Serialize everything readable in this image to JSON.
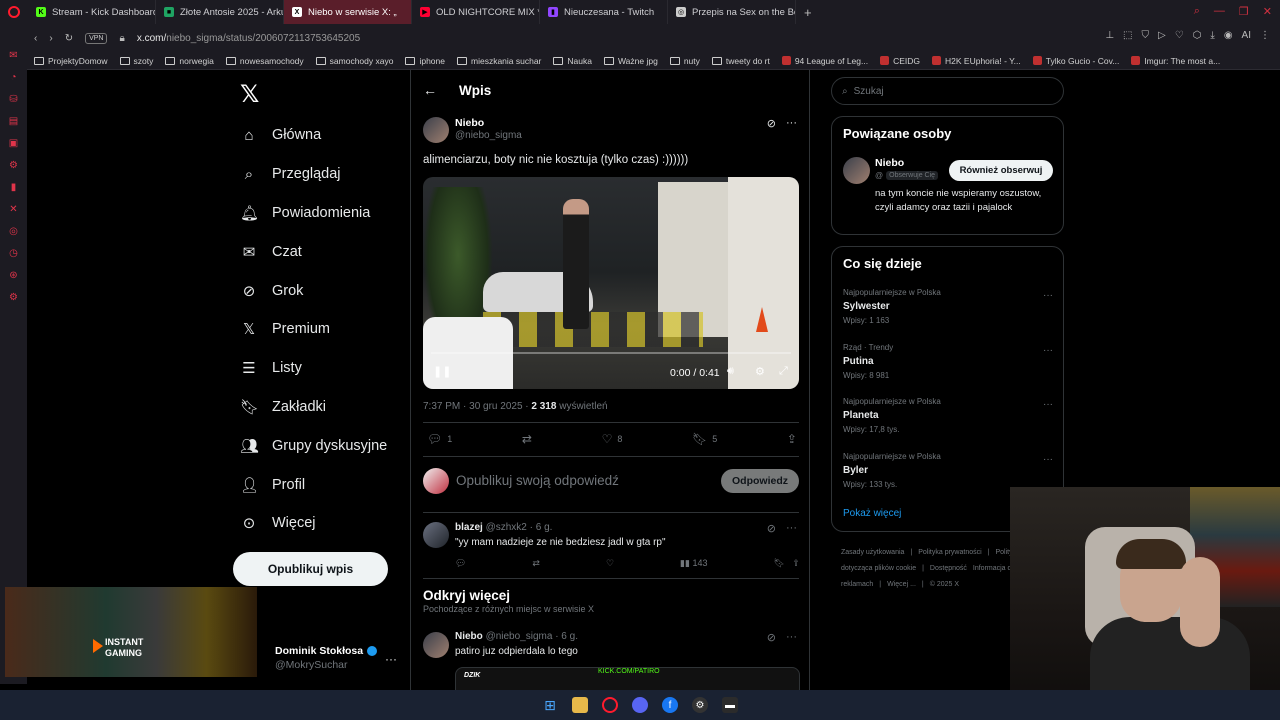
{
  "browser": {
    "tabs": [
      {
        "label": "Stream - Kick Dashboard",
        "fav_color": "#53fc18",
        "fav_glyph": "K",
        "active": false
      },
      {
        "label": "Złote Antosie 2025 - Arku",
        "fav_color": "#1fa463",
        "fav_glyph": "■",
        "active": false
      },
      {
        "label": "Niebo w serwisie X: „",
        "fav_color": "#ffffff",
        "fav_glyph": "X",
        "active": true
      },
      {
        "label": "OLD NIGHTCORE MIX *20",
        "fav_color": "#ff0033",
        "fav_glyph": "▶",
        "active": false
      },
      {
        "label": "Nieuczesana - Twitch",
        "fav_color": "#9146ff",
        "fav_glyph": "▮",
        "active": false
      },
      {
        "label": "Przepis na Sex on the Bea",
        "fav_color": "#cccccc",
        "fav_glyph": "◎",
        "active": false
      }
    ],
    "new_tab": "+",
    "vpn": "VPN",
    "url_host": "x.com/",
    "url_path": "niebo_sigma/status/2006072113753645205",
    "ai_label": "AI",
    "bookmarks": [
      {
        "label": "ProjektyDomow",
        "icon": "folder"
      },
      {
        "label": "szoty",
        "icon": "folder"
      },
      {
        "label": "norwegia",
        "icon": "folder"
      },
      {
        "label": "nowesamochody",
        "icon": "folder"
      },
      {
        "label": "samochody xayo",
        "icon": "folder"
      },
      {
        "label": "iphone",
        "icon": "folder"
      },
      {
        "label": "mieszkania suchar",
        "icon": "folder"
      },
      {
        "label": "Nauka",
        "icon": "folder"
      },
      {
        "label": "Ważne jpg",
        "icon": "folder"
      },
      {
        "label": "nuty",
        "icon": "folder"
      },
      {
        "label": "tweety do rt",
        "icon": "folder"
      },
      {
        "label": "94 League of Leg...",
        "icon": "site"
      },
      {
        "label": "CEIDG",
        "icon": "site"
      },
      {
        "label": "H2K EUphoria! - Y...",
        "icon": "site"
      },
      {
        "label": "Tylko Gucio - Cov...",
        "icon": "site"
      },
      {
        "label": "Imgur: The most a...",
        "icon": "site"
      }
    ]
  },
  "nav": {
    "items": [
      {
        "label": "Główna",
        "icon": "home-icon",
        "glyph": "⌂"
      },
      {
        "label": "Przeglądaj",
        "icon": "search-icon",
        "glyph": "⌕"
      },
      {
        "label": "Powiadomienia",
        "icon": "bell-icon",
        "glyph": "🔔︎"
      },
      {
        "label": "Czat",
        "icon": "mail-icon",
        "glyph": "✉"
      },
      {
        "label": "Grok",
        "icon": "grok-icon",
        "glyph": "⊘"
      },
      {
        "label": "Premium",
        "icon": "x-premium-icon",
        "glyph": "𝕏"
      },
      {
        "label": "Listy",
        "icon": "list-icon",
        "glyph": "☰"
      },
      {
        "label": "Zakładki",
        "icon": "bookmark-icon",
        "glyph": "🔖︎"
      },
      {
        "label": "Grupy dyskusyjne",
        "icon": "communities-icon",
        "glyph": "👥︎"
      },
      {
        "label": "Profil",
        "icon": "profile-icon",
        "glyph": "👤︎"
      },
      {
        "label": "Więcej",
        "icon": "more-icon",
        "glyph": "⊙"
      }
    ],
    "post_button": "Opublikuj wpis"
  },
  "account": {
    "name": "Dominik Stokłosa",
    "handle": "@MokrySuchar"
  },
  "overlay": {
    "brand_line1": "INSTANT",
    "brand_line2": "GAMING"
  },
  "main": {
    "header_title": "Wpis",
    "tweet": {
      "name": "Niebo",
      "handle": "@niebo_sigma",
      "text": "alimenciarzu, boty nic nie kosztuja (tylko czas)  :))))))",
      "video_time": "0:00 / 0:41",
      "video_progress": 0,
      "time": "7:37 PM · 30 gru 2025 · ",
      "views": "2 318",
      "views_label": " wyświetleń",
      "replies": "1",
      "likes": "8",
      "bookmarks": "5"
    },
    "reply_placeholder": "Opublikuj swoją odpowiedź",
    "reply_button": "Odpowiedz",
    "comment": {
      "name": "blazej",
      "handle": "@szhxk2 · 6 g.",
      "text": "\"yy mam nadzieje ze nie bedziesz jadl w gta rp\"",
      "views": "143"
    },
    "discover_title": "Odkryj więcej",
    "discover_sub": "Pochodzące z różnych miejsc w serwisie X",
    "discover_post": {
      "name": "Niebo",
      "handle": "@niebo_sigma · 6 g.",
      "text": "patiro juz odpierdala lo tego",
      "embed_left": "DZIK",
      "embed_right": "KICK.COM/PATIRO"
    }
  },
  "right": {
    "search_placeholder": "Szukaj",
    "related_title": "Powiązane osoby",
    "related": {
      "name": "Niebo",
      "handle": "@",
      "follows_you": "Obserwuje Cię",
      "button": "Również obserwuj",
      "bio": "na tym koncie nie wspieramy oszustow, czyli adamcy oraz tazii i pajalock"
    },
    "trends_title": "Co się dzieje",
    "trends": [
      {
        "context": "Najpopularniejsze w Polska",
        "name": "Sylwester",
        "count": "Wpisy: 1 163"
      },
      {
        "context": "Rząd · Trendy",
        "name": "Putina",
        "count": "Wpisy: 8 981"
      },
      {
        "context": "Najpopularniejsze w Polska",
        "name": "Planeta",
        "count": "Wpisy: 17,8 tys."
      },
      {
        "context": "Najpopularniejsze w Polska",
        "name": "Byler",
        "count": "Wpisy: 133 tys."
      }
    ],
    "show_more": "Pokaż więcej",
    "footer": [
      "Zasady użytkowania",
      "|",
      "Polityka prywatności",
      "|",
      "Polityka dotycząca plików cookie",
      "|",
      "Dostępność",
      "Informacja o reklamach",
      "|",
      "Więcej ...",
      "|",
      "© 2025 X"
    ]
  },
  "colors": {
    "accent": "#1d9bf0",
    "background": "#000000",
    "border": "#2f3336",
    "opera_red": "#ff1b2d"
  }
}
